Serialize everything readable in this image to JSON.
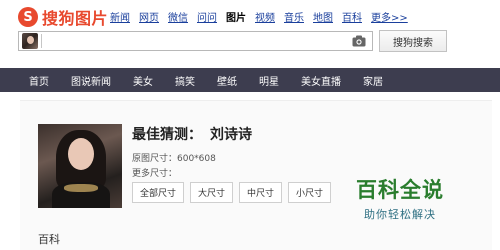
{
  "logo": {
    "mark": "S",
    "text": "搜狗图片"
  },
  "top_nav": [
    {
      "label": "新闻",
      "active": false
    },
    {
      "label": "网页",
      "active": false
    },
    {
      "label": "微信",
      "active": false
    },
    {
      "label": "问问",
      "active": false
    },
    {
      "label": "图片",
      "active": true
    },
    {
      "label": "视频",
      "active": false
    },
    {
      "label": "音乐",
      "active": false
    },
    {
      "label": "地图",
      "active": false
    },
    {
      "label": "百科",
      "active": false
    },
    {
      "label": "更多>>",
      "active": false
    }
  ],
  "search": {
    "value": "",
    "button_label": "搜狗搜索",
    "thumb_icon": "query-image-thumbnail",
    "camera_icon": "camera-icon"
  },
  "categories": [
    "首页",
    "图说新闻",
    "美女",
    "搞笑",
    "壁纸",
    "明星",
    "美女直播",
    "家居"
  ],
  "result": {
    "guess_label": "最佳猜测：",
    "guess_name": "刘诗诗",
    "original_size": "原图尺寸：600*608",
    "more_sizes_label": "更多尺寸：",
    "size_buttons": [
      "全部尺寸",
      "大尺寸",
      "中尺寸",
      "小尺寸"
    ],
    "section_label": "百科"
  },
  "watermark": {
    "main": "百科全说",
    "sub": "助你轻松解决"
  },
  "colors": {
    "brand_red": "#e8492e",
    "nav_link": "#1a3f9c",
    "category_bar": "#3d3d4f",
    "watermark_green": "#2a7d2e"
  }
}
